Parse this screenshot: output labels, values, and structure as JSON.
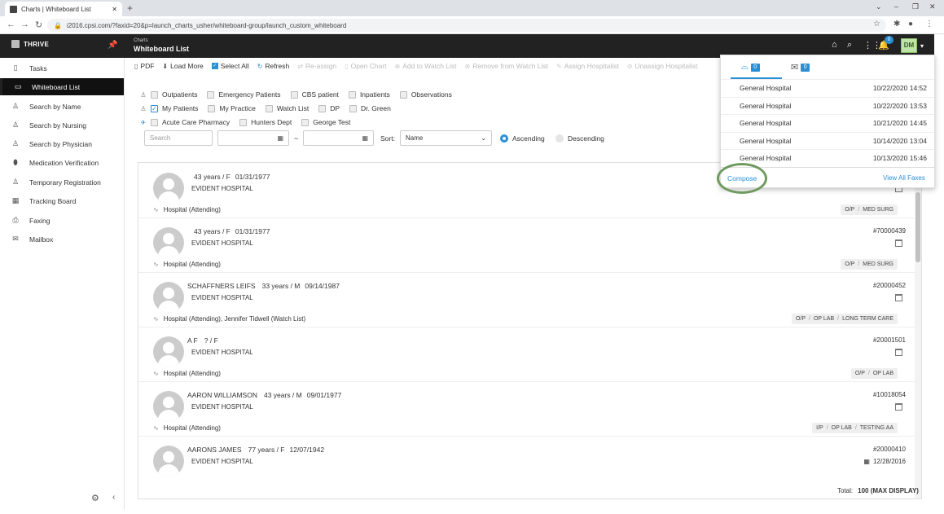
{
  "browser": {
    "tab_title": "Charts | Whiteboard List",
    "url": "i2016.cpsi.com/?faxid=20&p=launch_charts_usher/whiteboard-group/launch_custom_whiteboard"
  },
  "header": {
    "brand": "THRIVE",
    "subtitle": "Charts",
    "title": "Whiteboard List",
    "bell_count": "0",
    "avatar": "DM"
  },
  "sidebar": {
    "items": [
      {
        "label": "Tasks",
        "icon": "clipboard-icon"
      },
      {
        "label": "Whiteboard List",
        "icon": "whiteboard-icon"
      },
      {
        "label": "Search by Name",
        "icon": "person-search-icon"
      },
      {
        "label": "Search by Nursing",
        "icon": "person-search-icon"
      },
      {
        "label": "Search by Physician",
        "icon": "person-search-icon"
      },
      {
        "label": "Medication Verification",
        "icon": "pill-icon"
      },
      {
        "label": "Temporary Registration",
        "icon": "person-add-icon"
      },
      {
        "label": "Tracking Board",
        "icon": "board-icon"
      },
      {
        "label": "Faxing",
        "icon": "fax-icon"
      },
      {
        "label": "Mailbox",
        "icon": "mail-icon"
      }
    ]
  },
  "toolbar": {
    "pdf": "PDF",
    "load_more": "Load More",
    "select_all": "Select All",
    "refresh": "Refresh",
    "reassign": "Re-assign",
    "open_chart": "Open Chart",
    "add_watch": "Add to Watch List",
    "remove_watch": "Remove from Watch List",
    "assign_hosp": "Assign Hospitalist",
    "unassign_hosp": "Unassign Hospitalist"
  },
  "filters": {
    "row1": [
      "Outpatients",
      "Emergency Patients",
      "CBS patient",
      "Inpatients",
      "Observations"
    ],
    "row2": [
      "My Patients",
      "My Practice",
      "Watch List",
      "DP",
      "Dr. Green"
    ],
    "row3": [
      "Acute Care Pharmacy",
      "Hunters Dept",
      "George Test"
    ],
    "search_placeholder": "Search",
    "date_sep": "~",
    "sort_label": "Sort:",
    "sort_value": "Name",
    "ascending": "Ascending",
    "descending": "Descending"
  },
  "patients": [
    {
      "name": "",
      "age": "43 years / F",
      "dob": "01/31/1977",
      "hospital": "EVIDENT HOSPITAL",
      "mrn": "",
      "caldate": "",
      "attending": "Hospital (Attending)",
      "tags": [
        "O/P",
        "MED SURG"
      ]
    },
    {
      "name": "",
      "age": "43 years / F",
      "dob": "01/31/1977",
      "hospital": "EVIDENT HOSPITAL",
      "mrn": "#70000439",
      "caldate": "",
      "attending": "Hospital (Attending)",
      "tags": [
        "O/P",
        "MED SURG"
      ]
    },
    {
      "name": "SCHAFFNERS LEIFS",
      "age": "33 years / M",
      "dob": "09/14/1987",
      "hospital": "EVIDENT HOSPITAL",
      "mrn": "#20000452",
      "caldate": "",
      "attending": "Hospital (Attending), Jennifer Tidwell (Watch List)",
      "tags": [
        "O/P",
        "OP LAB",
        "LONG TERM CARE"
      ]
    },
    {
      "name": "A F",
      "age": "? / F",
      "dob": "",
      "hospital": "EVIDENT HOSPITAL",
      "mrn": "#20001501",
      "caldate": "",
      "attending": "Hospital (Attending)",
      "tags": [
        "O/P",
        "OP LAB"
      ]
    },
    {
      "name": "AARON WILLIAMSON",
      "age": "43 years / M",
      "dob": "09/01/1977",
      "hospital": "EVIDENT HOSPITAL",
      "mrn": "#10018054",
      "caldate": "",
      "attending": "Hospital (Attending)",
      "tags": [
        "I/P",
        "OP LAB",
        "TESTING AA"
      ]
    },
    {
      "name": "AARONS JAMES",
      "age": "77 years / F",
      "dob": "12/07/1942",
      "hospital": "EVIDENT HOSPITAL",
      "mrn": "#20000410",
      "caldate": "12/28/2016",
      "attending": "",
      "tags": []
    }
  ],
  "footer": {
    "total_label": "Total:",
    "total_value": "100 (MAX DISPLAY)"
  },
  "fax_popup": {
    "inbox_count": "0",
    "mail_count": "0",
    "rows": [
      {
        "name": "General Hospital",
        "date": "10/22/2020 14:52"
      },
      {
        "name": "General Hospital",
        "date": "10/22/2020 13:53"
      },
      {
        "name": "General Hospital",
        "date": "10/21/2020 14:45"
      },
      {
        "name": "General Hospital",
        "date": "10/14/2020 13:04"
      },
      {
        "name": "General Hospital",
        "date": "10/13/2020 15:46"
      }
    ],
    "compose": "Compose",
    "view_all": "View All Faxes"
  },
  "colors": {
    "accent": "#2b8fd6",
    "header": "#222222",
    "highlight_circle": "#6e9a5e"
  }
}
